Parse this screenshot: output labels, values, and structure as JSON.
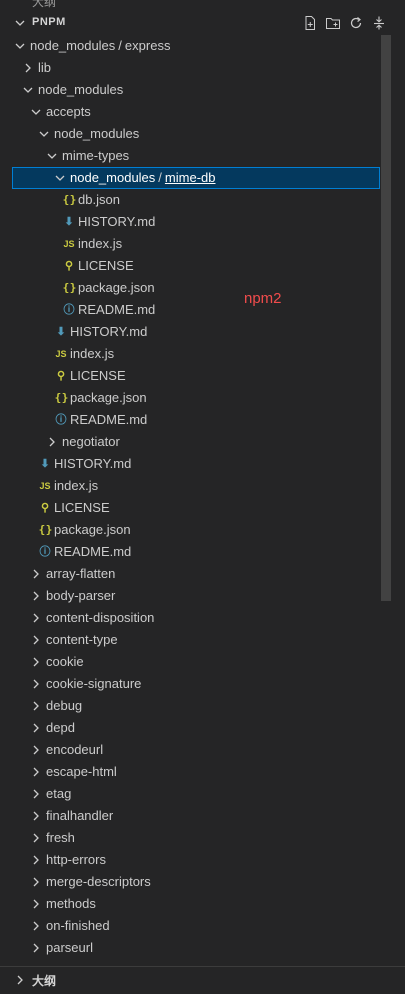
{
  "panel": {
    "title": "PNPM",
    "actions": [
      "new-file-icon",
      "new-folder-icon",
      "refresh-icon",
      "collapse-all-icon"
    ]
  },
  "tree": [
    {
      "label": "node_modules",
      "label2": "express",
      "type": "folder",
      "expanded": true,
      "depth": 0
    },
    {
      "label": "lib",
      "type": "folder",
      "expanded": false,
      "depth": 1
    },
    {
      "label": "node_modules",
      "type": "folder",
      "expanded": true,
      "depth": 1
    },
    {
      "label": "accepts",
      "type": "folder",
      "expanded": true,
      "depth": 2
    },
    {
      "label": "node_modules",
      "type": "folder",
      "expanded": true,
      "depth": 3
    },
    {
      "label": "mime-types",
      "type": "folder",
      "expanded": true,
      "depth": 4
    },
    {
      "label": "node_modules",
      "label2": "mime-db",
      "type": "folder",
      "expanded": true,
      "depth": 5,
      "selected": true
    },
    {
      "label": "db.json",
      "type": "json",
      "depth": 6
    },
    {
      "label": "HISTORY.md",
      "type": "md",
      "depth": 6
    },
    {
      "label": "index.js",
      "type": "js",
      "depth": 6
    },
    {
      "label": "LICENSE",
      "type": "license",
      "depth": 6
    },
    {
      "label": "package.json",
      "type": "json",
      "depth": 6
    },
    {
      "label": "README.md",
      "type": "info",
      "depth": 6
    },
    {
      "label": "HISTORY.md",
      "type": "md",
      "depth": 5
    },
    {
      "label": "index.js",
      "type": "js",
      "depth": 5
    },
    {
      "label": "LICENSE",
      "type": "license",
      "depth": 5
    },
    {
      "label": "package.json",
      "type": "json",
      "depth": 5
    },
    {
      "label": "README.md",
      "type": "info",
      "depth": 5
    },
    {
      "label": "negotiator",
      "type": "folder",
      "expanded": false,
      "depth": 4
    },
    {
      "label": "HISTORY.md",
      "type": "md",
      "depth": 3
    },
    {
      "label": "index.js",
      "type": "js",
      "depth": 3
    },
    {
      "label": "LICENSE",
      "type": "license",
      "depth": 3
    },
    {
      "label": "package.json",
      "type": "json",
      "depth": 3
    },
    {
      "label": "README.md",
      "type": "info",
      "depth": 3
    },
    {
      "label": "array-flatten",
      "type": "folder",
      "expanded": false,
      "depth": 2
    },
    {
      "label": "body-parser",
      "type": "folder",
      "expanded": false,
      "depth": 2
    },
    {
      "label": "content-disposition",
      "type": "folder",
      "expanded": false,
      "depth": 2
    },
    {
      "label": "content-type",
      "type": "folder",
      "expanded": false,
      "depth": 2
    },
    {
      "label": "cookie",
      "type": "folder",
      "expanded": false,
      "depth": 2
    },
    {
      "label": "cookie-signature",
      "type": "folder",
      "expanded": false,
      "depth": 2
    },
    {
      "label": "debug",
      "type": "folder",
      "expanded": false,
      "depth": 2
    },
    {
      "label": "depd",
      "type": "folder",
      "expanded": false,
      "depth": 2
    },
    {
      "label": "encodeurl",
      "type": "folder",
      "expanded": false,
      "depth": 2
    },
    {
      "label": "escape-html",
      "type": "folder",
      "expanded": false,
      "depth": 2
    },
    {
      "label": "etag",
      "type": "folder",
      "expanded": false,
      "depth": 2
    },
    {
      "label": "finalhandler",
      "type": "folder",
      "expanded": false,
      "depth": 2
    },
    {
      "label": "fresh",
      "type": "folder",
      "expanded": false,
      "depth": 2
    },
    {
      "label": "http-errors",
      "type": "folder",
      "expanded": false,
      "depth": 2
    },
    {
      "label": "merge-descriptors",
      "type": "folder",
      "expanded": false,
      "depth": 2
    },
    {
      "label": "methods",
      "type": "folder",
      "expanded": false,
      "depth": 2
    },
    {
      "label": "on-finished",
      "type": "folder",
      "expanded": false,
      "depth": 2
    },
    {
      "label": "parseurl",
      "type": "folder",
      "expanded": false,
      "depth": 2
    }
  ],
  "annotation": "npm2",
  "outline": {
    "title": "大纲"
  },
  "colors": {
    "background": "#252526",
    "selection": "#04395e",
    "selection_border": "#007fd4",
    "annotation": "#f14c4c",
    "json_icon": "#cbcb41",
    "md_icon": "#519aba"
  }
}
